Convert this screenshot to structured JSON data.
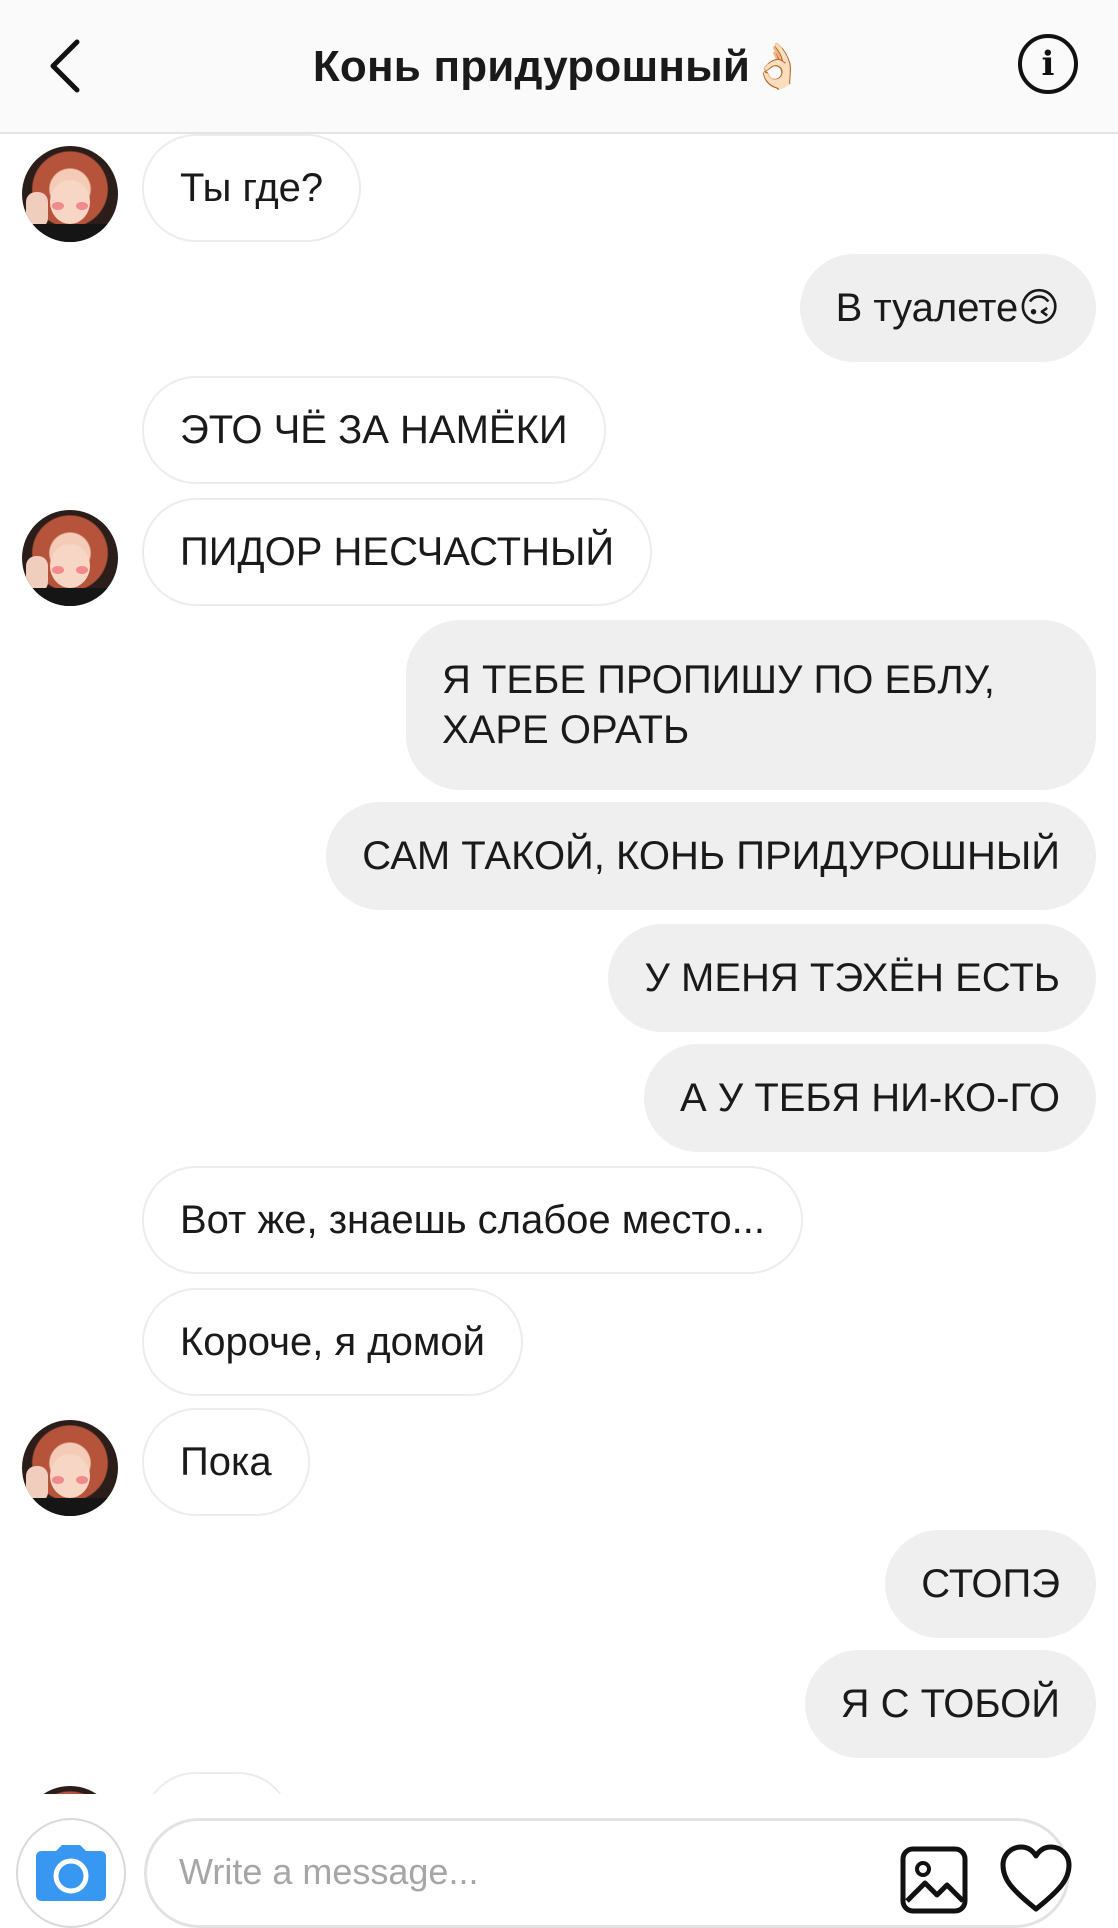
{
  "header": {
    "title": "Конь придурошный👌🏻",
    "info_glyph": "i"
  },
  "messages": [
    {
      "side": "in",
      "text": "Ты где?"
    },
    {
      "side": "out",
      "text": "В туалете🙃"
    },
    {
      "side": "in",
      "text": "ЭТО ЧЁ ЗА НАМЁКИ"
    },
    {
      "side": "in",
      "text": "ПИДОР НЕСЧАСТНЫЙ"
    },
    {
      "side": "out",
      "text": "Я ТЕБЕ ПРОПИШУ ПО ЕБЛУ, ХАРЕ ОРАТЬ"
    },
    {
      "side": "out",
      "text": "САМ ТАКОЙ, КОНЬ ПРИДУРОШНЫЙ"
    },
    {
      "side": "out",
      "text": "У МЕНЯ ТЭХЁН ЕСТЬ"
    },
    {
      "side": "out",
      "text": "А У ТЕБЯ НИ-КО-ГО"
    },
    {
      "side": "in",
      "text": "Вот же, знаешь слабое место..."
    },
    {
      "side": "in",
      "text": "Короче, я домой"
    },
    {
      "side": "in",
      "text": "Пока"
    },
    {
      "side": "out",
      "text": "СТОПЭ"
    },
    {
      "side": "out",
      "text": "Я С ТОБОЙ"
    }
  ],
  "composer": {
    "placeholder": "Write a message...",
    "value": ""
  },
  "colors": {
    "incoming_bubble_border": "#ececec",
    "outgoing_bubble_bg": "#efefef",
    "camera_blue": "#3897f0"
  },
  "icons": [
    "back-chevron-icon",
    "info-icon",
    "camera-icon",
    "gallery-icon",
    "heart-icon"
  ]
}
